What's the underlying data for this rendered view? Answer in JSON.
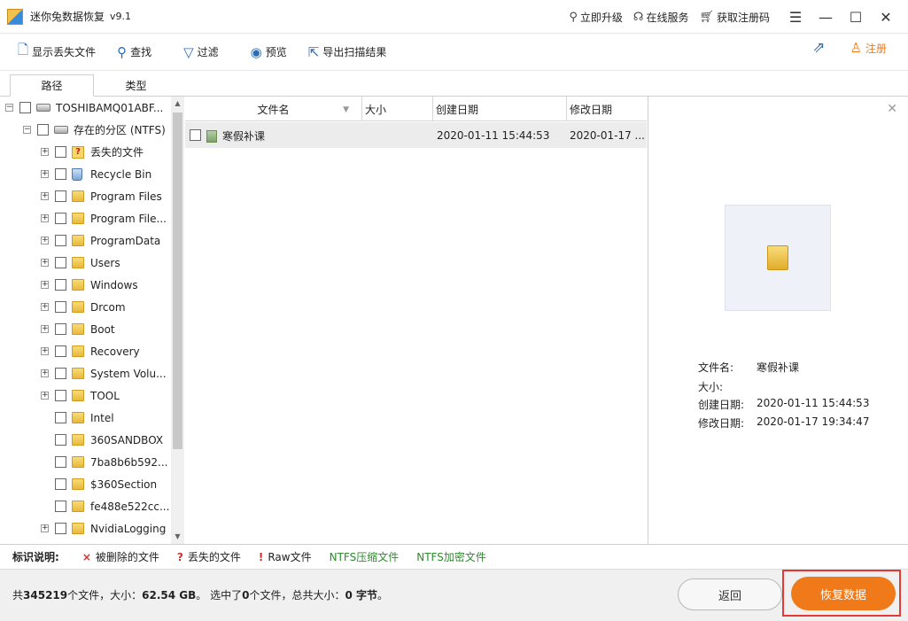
{
  "window": {
    "title": "迷你兔数据恢复",
    "version": "v9.1",
    "links": [
      {
        "label": "立即升级",
        "icon": "upgrade-icon"
      },
      {
        "label": "在线服务",
        "icon": "headset-icon"
      },
      {
        "label": "获取注册码",
        "icon": "cart-icon"
      }
    ]
  },
  "toolbar": {
    "show_lost": "显示丢失文件",
    "find": "查找",
    "filter": "过滤",
    "preview": "预览",
    "export": "导出扫描结果",
    "register": "注册"
  },
  "tabs": {
    "path": "路径",
    "type": "类型"
  },
  "tree": {
    "drive": "TOSHIBAMQ01ABF...",
    "partition": "存在的分区 (NTFS)",
    "items": [
      {
        "label": "丢失的文件",
        "icon": "lost-files-icon",
        "expandable": true
      },
      {
        "label": "Recycle Bin",
        "icon": "recycle-bin-icon",
        "expandable": true
      },
      {
        "label": "Program Files",
        "icon": "folder-icon",
        "expandable": true
      },
      {
        "label": "Program File...",
        "icon": "folder-icon",
        "expandable": true
      },
      {
        "label": "ProgramData",
        "icon": "folder-icon",
        "expandable": true
      },
      {
        "label": "Users",
        "icon": "folder-icon",
        "expandable": true
      },
      {
        "label": "Windows",
        "icon": "folder-icon",
        "expandable": true
      },
      {
        "label": "Drcom",
        "icon": "folder-icon",
        "expandable": true
      },
      {
        "label": "Boot",
        "icon": "folder-icon",
        "expandable": true
      },
      {
        "label": "Recovery",
        "icon": "folder-icon",
        "expandable": true
      },
      {
        "label": "System Volu...",
        "icon": "folder-icon",
        "expandable": true
      },
      {
        "label": "TOOL",
        "icon": "folder-icon",
        "expandable": true
      },
      {
        "label": "Intel",
        "icon": "folder-icon",
        "expandable": false
      },
      {
        "label": "360SANDBOX",
        "icon": "folder-icon",
        "expandable": false
      },
      {
        "label": "7ba8b6b592...",
        "icon": "folder-icon",
        "expandable": false
      },
      {
        "label": "$360Section",
        "icon": "folder-icon",
        "expandable": false
      },
      {
        "label": "fe488e522cc...",
        "icon": "folder-icon",
        "expandable": false
      },
      {
        "label": "NvidiaLogging",
        "icon": "folder-icon",
        "expandable": true
      }
    ]
  },
  "file_list": {
    "columns": {
      "name": "文件名",
      "size": "大小",
      "created": "创建日期",
      "modified": "修改日期"
    },
    "rows": [
      {
        "name": "寒假补课",
        "size": "",
        "created": "2020-01-11 15:44:53",
        "modified": "2020-01-17 ..."
      }
    ]
  },
  "preview": {
    "name_label": "文件名:",
    "name_value": "寒假补课",
    "size_label": "大小:",
    "size_value": "",
    "created_label": "创建日期:",
    "created_value": "2020-01-11 15:44:53",
    "modified_label": "修改日期:",
    "modified_value": "2020-01-17 19:34:47"
  },
  "legend": {
    "title": "标识说明:",
    "items": [
      {
        "mark": "×",
        "label": "被删除的文件",
        "color": "#d32f2f",
        "label_color": "#222222"
      },
      {
        "mark": "?",
        "label": "丢失的文件",
        "color": "#d32f2f",
        "label_color": "#222222"
      },
      {
        "mark": "!",
        "label": "Raw文件",
        "color": "#d32f2f",
        "label_color": "#222222"
      },
      {
        "mark": "",
        "label": "NTFS压缩文件",
        "color": "",
        "label_color": "#2e8b2e"
      },
      {
        "mark": "",
        "label": "NTFS加密文件",
        "color": "",
        "label_color": "#2e8b2e"
      }
    ]
  },
  "status": {
    "p1": "共",
    "total_files": "345219",
    "p2": "个文件，大小：",
    "total_size": "62.54 GB",
    "p3": "。 选中了",
    "selected": "0",
    "p4": "个文件，总共大小：",
    "selected_size": "0 字节",
    "p5": "。"
  },
  "buttons": {
    "back": "返回",
    "recover": "恢复数据"
  },
  "colors": {
    "accent": "#f07a1a",
    "toolbar_icon": "#2d6db5",
    "highlight": "#e53935"
  }
}
